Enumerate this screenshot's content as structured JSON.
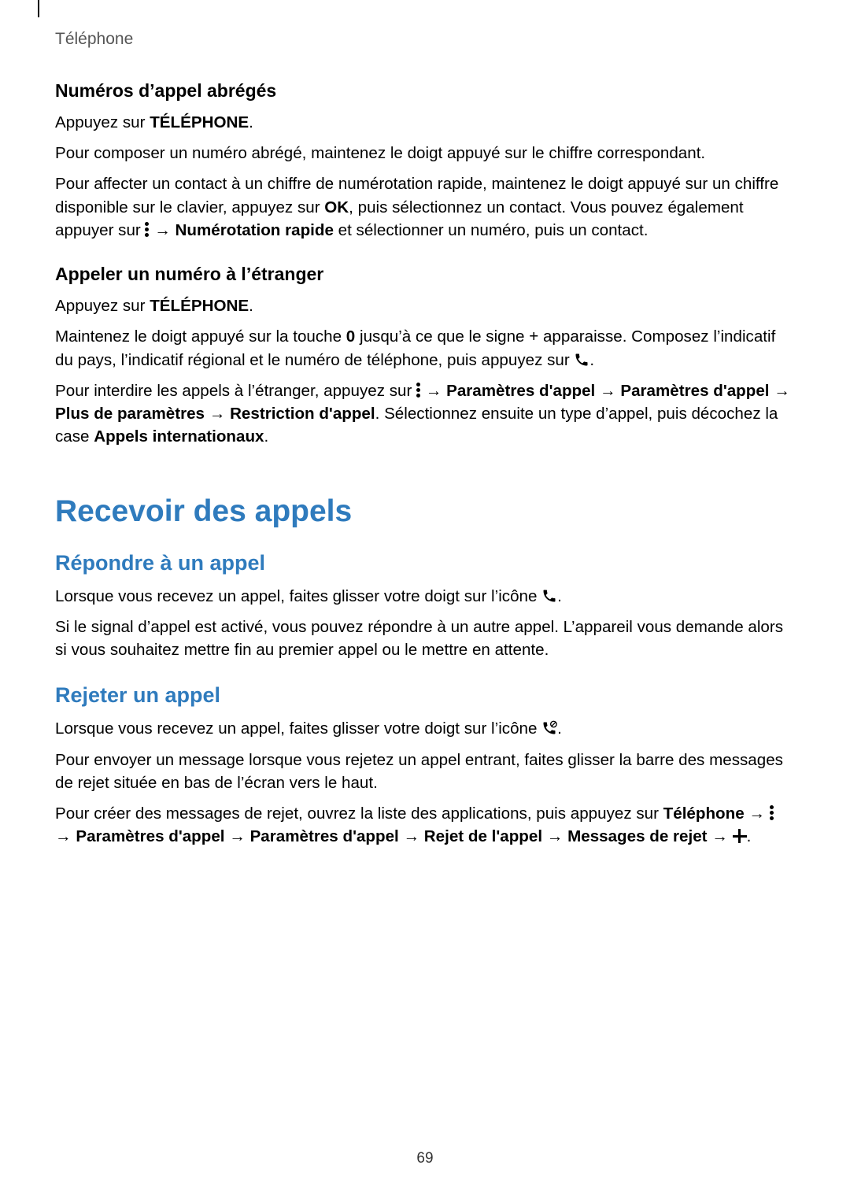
{
  "header": {
    "section": "Téléphone"
  },
  "speed_dial": {
    "heading": "Numéros d’appel abrégés",
    "p1a": "Appuyez sur ",
    "p1b": "TÉLÉPHONE",
    "p1c": ".",
    "p2": "Pour composer un numéro abrégé, maintenez le doigt appuyé sur le chiffre correspondant.",
    "p3a": "Pour affecter un contact à un chiffre de numérotation rapide, maintenez le doigt appuyé sur un chiffre disponible sur le clavier, appuyez sur ",
    "p3b": "OK",
    "p3c": ", puis sélectionnez un contact. Vous pouvez également appuyer sur ",
    "arrow": " → ",
    "p3d": "Numérotation rapide",
    "p3e": " et sélectionner un numéro, puis un contact."
  },
  "intl": {
    "heading": "Appeler un numéro à l’étranger",
    "p1a": "Appuyez sur ",
    "p1b": "TÉLÉPHONE",
    "p1c": ".",
    "p2a": "Maintenez le doigt appuyé sur la touche ",
    "p2b": "0",
    "p2c": " jusqu’à ce que le signe + apparaisse. Composez l’indicatif du pays, l’indicatif régional et le numéro de téléphone, puis appuyez sur ",
    "p2d": ".",
    "p3a": "Pour interdire les appels à l’étranger, appuyez sur ",
    "arrow": " → ",
    "p3b": "Paramètres d'appel",
    "p3c": "Paramètres d'appel",
    "p3d": "Plus de paramètres",
    "p3e": "Restriction d'appel",
    "p3f": ". Sélectionnez ensuite un type d’appel, puis décochez la case ",
    "p3g": "Appels internationaux",
    "p3h": "."
  },
  "receive": {
    "title": "Recevoir des appels"
  },
  "answer": {
    "heading": "Répondre à un appel",
    "p1a": "Lorsque vous recevez un appel, faites glisser votre doigt sur l’icône ",
    "p1b": ".",
    "p2": "Si le signal d’appel est activé, vous pouvez répondre à un autre appel. L’appareil vous demande alors si vous souhaitez mettre fin au premier appel ou le mettre en attente."
  },
  "reject": {
    "heading": "Rejeter un appel",
    "p1a": "Lorsque vous recevez un appel, faites glisser votre doigt sur l’icône ",
    "p1b": ".",
    "p2": "Pour envoyer un message lorsque vous rejetez un appel entrant, faites glisser la barre des messages de rejet située en bas de l’écran vers le haut.",
    "p3a": "Pour créer des messages de rejet, ouvrez la liste des applications, puis appuyez sur ",
    "p3b": "Téléphone",
    "arrow": " → ",
    "p3c": "Paramètres d'appel",
    "p3d": "Paramètres d'appel",
    "p3e": "Rejet de l'appel",
    "p3f": "Messages de rejet",
    "p3g": "."
  },
  "page_number": "69"
}
